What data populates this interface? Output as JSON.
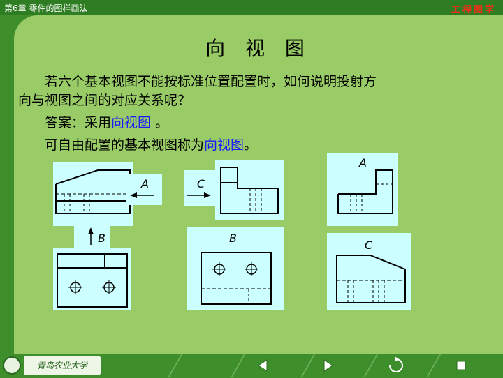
{
  "header": {
    "chapter": "第6章  零件的图样画法",
    "brand": "工程图学"
  },
  "title": "向 视 图",
  "question": {
    "line1": "若六个基本视图不能按标准位置配置时，如何说明投射方",
    "line2": "向与视图之间的对应关系呢？"
  },
  "answer": {
    "prefix": "答案：采用",
    "term": "向视图",
    "suffix": " 。"
  },
  "definition": {
    "text": "可自由配置的基本视图称为",
    "term": "向视图",
    "end": "。"
  },
  "drawing_labels": {
    "arrow_a": "A",
    "arrow_b": "B",
    "arrow_c": "C",
    "view_a": "A",
    "view_b": "B",
    "view_c": "C"
  },
  "footer": {
    "logo_text": "青岛农业大学"
  },
  "colors": {
    "background": "#3e8e2c",
    "content": "#99cc66",
    "panel": "#ccffff",
    "highlight": "#1a1aff",
    "brand": "#ff2a1a"
  }
}
